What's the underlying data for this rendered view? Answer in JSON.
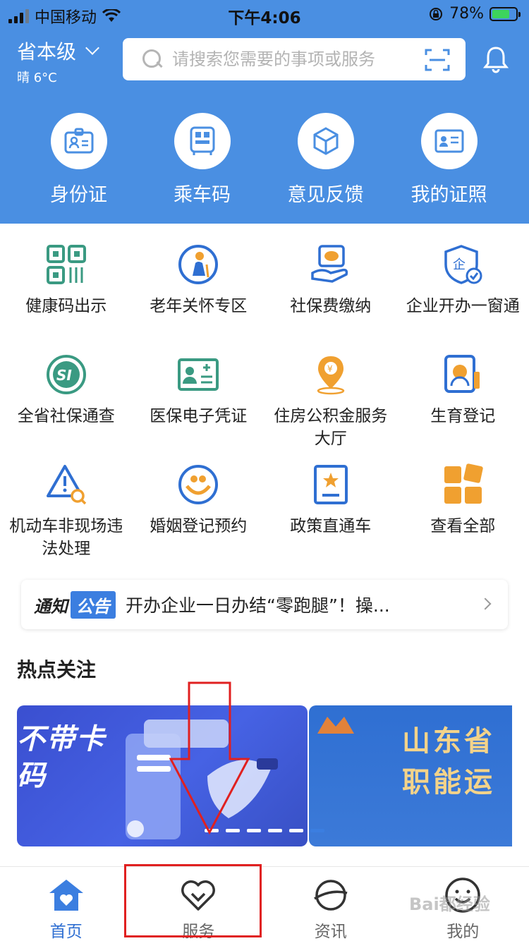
{
  "status_bar": {
    "carrier": "中国移动",
    "time": "下午4:06",
    "battery": "78%"
  },
  "header": {
    "region": "省本级",
    "weather": "晴 6°C",
    "search_placeholder": "请搜索您需要的事项或服务",
    "quick_actions": [
      {
        "label": "身份证",
        "icon": "id-card-icon"
      },
      {
        "label": "乘车码",
        "icon": "bus-code-icon"
      },
      {
        "label": "意见反馈",
        "icon": "cube-icon"
      },
      {
        "label": "我的证照",
        "icon": "license-icon"
      }
    ]
  },
  "services": [
    {
      "label": "健康码出示",
      "icon": "qr-code-icon"
    },
    {
      "label": "老年关怀专区",
      "icon": "elderly-icon"
    },
    {
      "label": "社保费缴纳",
      "icon": "social-security-payment-icon"
    },
    {
      "label": "企业开办一窗通",
      "icon": "enterprise-icon"
    },
    {
      "label": "全省社保通查",
      "icon": "si-icon"
    },
    {
      "label": "医保电子凭证",
      "icon": "medical-card-icon"
    },
    {
      "label": "住房公积金服务大厅",
      "icon": "housing-fund-icon"
    },
    {
      "label": "生育登记",
      "icon": "birth-registration-icon"
    },
    {
      "label": "机动车非现场违法处理",
      "icon": "warning-icon"
    },
    {
      "label": "婚姻登记预约",
      "icon": "marriage-icon"
    },
    {
      "label": "政策直通车",
      "icon": "policy-book-icon"
    },
    {
      "label": "查看全部",
      "icon": "grid-all-icon"
    }
  ],
  "notice": {
    "tag1": "通知",
    "tag2": "公告",
    "text": "开办企业一日办结“零跑腿”！操..."
  },
  "hot_section": {
    "title": "热点关注",
    "banner1_text": "不带卡\n码",
    "banner2_text": "山东省\n职能运"
  },
  "tabbar": [
    {
      "label": "首页",
      "icon": "home-icon",
      "active": true
    },
    {
      "label": "服务",
      "icon": "heart-icon",
      "active": false
    },
    {
      "label": "资讯",
      "icon": "planet-icon",
      "active": false
    },
    {
      "label": "我的",
      "icon": "smile-icon",
      "active": false
    }
  ],
  "colors": {
    "primary": "#4a8fe2",
    "accent": "#2f6fd2",
    "teal": "#3a9a82",
    "orange": "#f0a030",
    "annotation": "#e02020"
  },
  "watermark": "Bai都经验"
}
